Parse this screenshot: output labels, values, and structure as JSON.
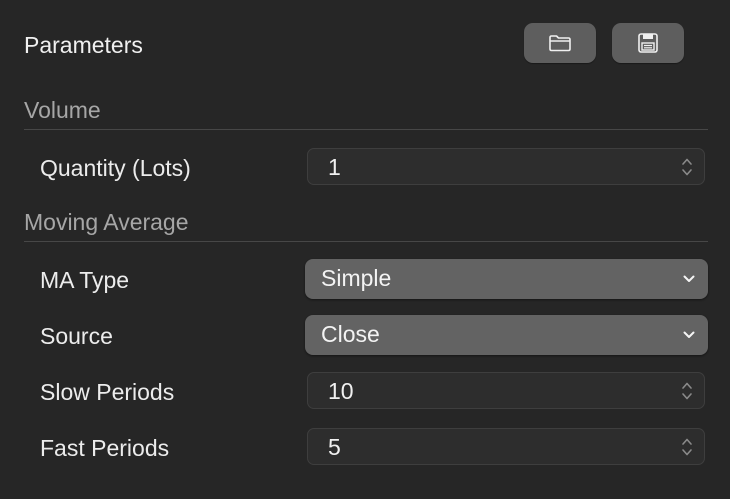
{
  "header": {
    "title": "Parameters",
    "open_icon": "folder-icon",
    "save_icon": "floppy-disk-icon"
  },
  "volume": {
    "section_title": "Volume",
    "quantity_label": "Quantity (Lots)",
    "quantity_value": "1"
  },
  "moving_average": {
    "section_title": "Moving Average",
    "ma_type_label": "MA Type",
    "ma_type_value": "Simple",
    "source_label": "Source",
    "source_value": "Close",
    "slow_label": "Slow Periods",
    "slow_value": "10",
    "fast_label": "Fast Periods",
    "fast_value": "5"
  },
  "colors": {
    "background": "#262626",
    "control_bg": "#2d2d2d",
    "popup_bg": "#636363",
    "section_text": "#a6a6a6"
  }
}
